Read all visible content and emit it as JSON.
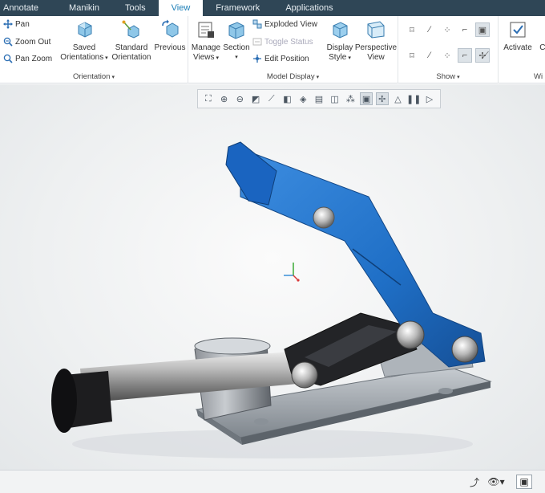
{
  "tabs": [
    {
      "label": "Annotate",
      "active": false
    },
    {
      "label": "Manikin",
      "active": false
    },
    {
      "label": "Tools",
      "active": false
    },
    {
      "label": "View",
      "active": true
    },
    {
      "label": "Framework",
      "active": false
    },
    {
      "label": "Applications",
      "active": false
    }
  ],
  "ribbon": {
    "orientation": {
      "pan": "Pan",
      "zoom_out": "Zoom Out",
      "pan_zoom": "Pan Zoom",
      "saved_orientations_1": "Saved",
      "saved_orientations_2": "Orientations",
      "standard_orientation_1": "Standard",
      "standard_orientation_2": "Orientation",
      "previous": "Previous",
      "label": "Orientation"
    },
    "model_display": {
      "manage_views_1": "Manage",
      "manage_views_2": "Views",
      "section": "Section",
      "exploded_view": "Exploded View",
      "toggle_status": "Toggle Status",
      "edit_position": "Edit Position",
      "display_style_1": "Display",
      "display_style_2": "Style",
      "perspective_view_1": "Perspective",
      "perspective_view_2": "View",
      "label": "Model Display"
    },
    "show": {
      "label": "Show"
    },
    "window": {
      "activate": "Activate",
      "close_partial": "Cl",
      "label_partial": "Wi"
    }
  },
  "colors": {
    "tabbar": "#2f4656",
    "active_tab_text": "#1c7fb8",
    "handle_blue": "#1f6fc6",
    "viewport_bg": "#eef0f1"
  }
}
